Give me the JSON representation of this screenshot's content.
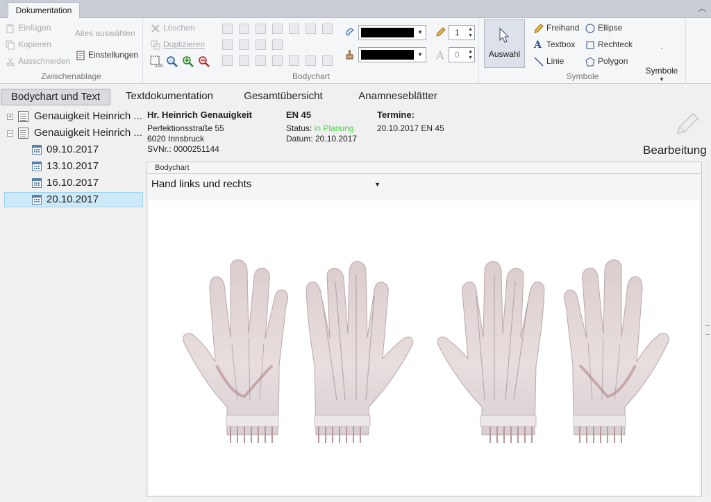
{
  "window": {
    "tab": "Dokumentation",
    "collapse_icon": "chevron-up-icon"
  },
  "ribbon": {
    "clipboard": {
      "label": "Zwischenablage",
      "paste": "Einfügen",
      "copy": "Kopieren",
      "cut": "Ausschneiden",
      "select_all": "Alles auswählen",
      "settings": "Einstellungen"
    },
    "bodychart": {
      "label": "Bodychart",
      "delete": "Löschen",
      "duplicate": "Duplizieren",
      "stroke_color": "#000000",
      "fill_color": "#000000",
      "line_width": "1",
      "font_size": "0"
    },
    "symbols": {
      "label": "Symbole",
      "select": "Auswahl",
      "freehand": "Freihand",
      "textbox": "Textbox",
      "line": "Linie",
      "ellipse": "Ellipse",
      "rectangle": "Rechteck",
      "polygon": "Polygon",
      "symbols_menu": "Symbole",
      "dot": "·"
    }
  },
  "view_tabs": [
    {
      "label": "Bodychart und Text",
      "active": true
    },
    {
      "label": "Textdokumentation",
      "active": false
    },
    {
      "label": "Gesamtübersicht",
      "active": false
    },
    {
      "label": "Anamneseblätter",
      "active": false
    }
  ],
  "tree": {
    "items": [
      {
        "label": "Genauigkeit Heinrich ...",
        "expander": "+"
      },
      {
        "label": "Genauigkeit Heinrich ...",
        "expander": "−"
      }
    ],
    "dates": [
      "09.10.2017",
      "13.10.2017",
      "16.10.2017",
      "20.10.2017"
    ],
    "selected_date": "20.10.2017"
  },
  "patient": {
    "name": "Hr. Heinrich Genauigkeit",
    "street": "Perfektionsstraße 55",
    "city": "6020 Innsbruck",
    "svnr": "SVNr.: 0000251144"
  },
  "episode": {
    "code": "EN 45",
    "status_label": "Status:",
    "status_value": "in Planung",
    "status_color": "#4cd64c",
    "date": "Datum: 20.10.2017"
  },
  "appointments": {
    "title": "Termine:",
    "entry": "20.10.2017 EN 45"
  },
  "edit": {
    "label": "Bearbeitung",
    "icon": "pencil-icon"
  },
  "bodychart_panel": {
    "title": "Bodychart",
    "selected": "Hand links und rechts",
    "image_icon": "hands-anatomy-illustration"
  }
}
